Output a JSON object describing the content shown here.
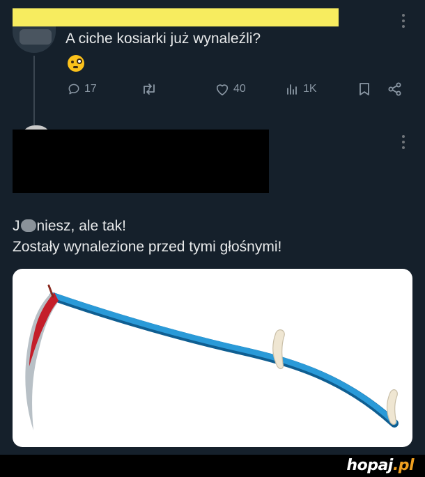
{
  "tweet1": {
    "text": "A ciche kosiarki już wynaleźli?",
    "emoji": "face-with-monocle",
    "stats": {
      "replies": "17",
      "likes": "40",
      "views": "1K"
    }
  },
  "tweet2": {
    "line1_start": "J",
    "line1_end": "niesz, ale tak!",
    "line2": "Zostały wynalezione przed tymi głośnymi!",
    "media_description": "scythe-with-blue-handle"
  },
  "watermark": {
    "brand": "hopaj",
    "tld": ".pl"
  },
  "colors": {
    "background": "#15202b",
    "text": "#e7e9ea",
    "muted": "#8b98a5",
    "redaction_yellow": "#f7ec5f",
    "scythe_handle": "#1f86c6",
    "scythe_blade": "#c41e2a",
    "watermark_accent": "#f0a020"
  }
}
